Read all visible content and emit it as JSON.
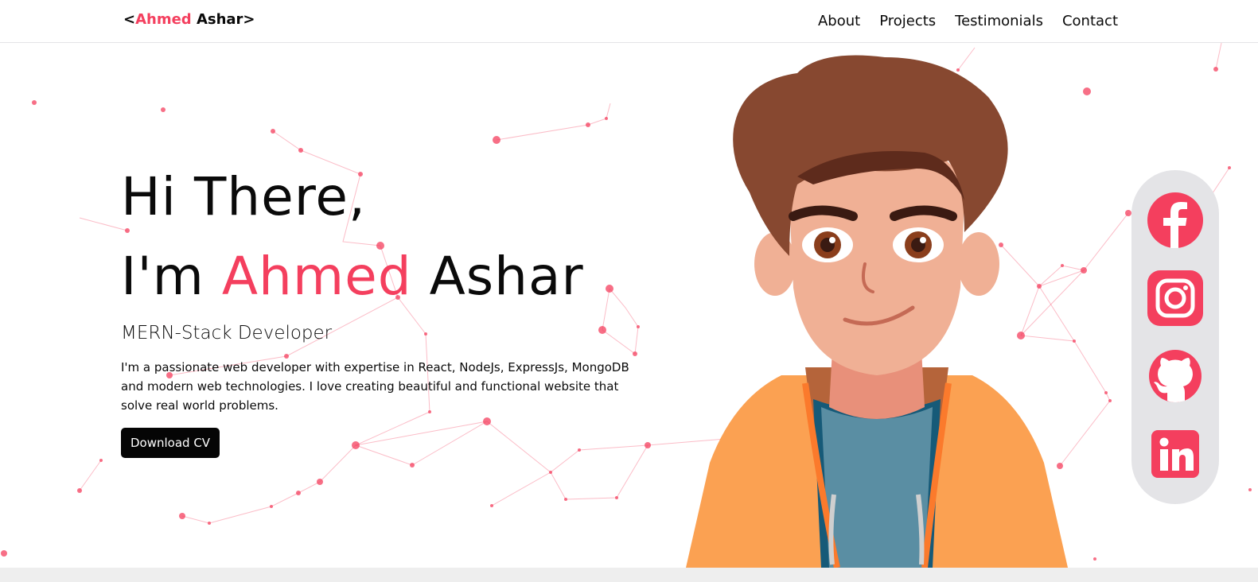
{
  "header": {
    "logo": {
      "prefix": "<",
      "first": "Ahmed",
      "rest": " Ashar>"
    },
    "nav": [
      {
        "label": "About"
      },
      {
        "label": "Projects"
      },
      {
        "label": "Testimonials"
      },
      {
        "label": "Contact"
      }
    ]
  },
  "hero": {
    "greeting": "Hi There,",
    "intro_prefix": "I'm ",
    "first_name": "Ahmed",
    "last_name": " Ashar",
    "role": "MERN-Stack Developer",
    "description": "I'm a passionate web developer with expertise in React, NodeJs, ExpressJs, MongoDB and modern web technologies. I love creating beautiful and functional website that solve real world problems.",
    "cta_label": "Download CV"
  },
  "social": [
    {
      "icon": "facebook-icon"
    },
    {
      "icon": "instagram-icon"
    },
    {
      "icon": "github-icon"
    },
    {
      "icon": "linkedin-icon"
    }
  ],
  "colors": {
    "accent": "#f43f5e",
    "text": "#0a0a0a",
    "button_bg": "#050505",
    "social_bar_bg": "#e4e4e7"
  }
}
